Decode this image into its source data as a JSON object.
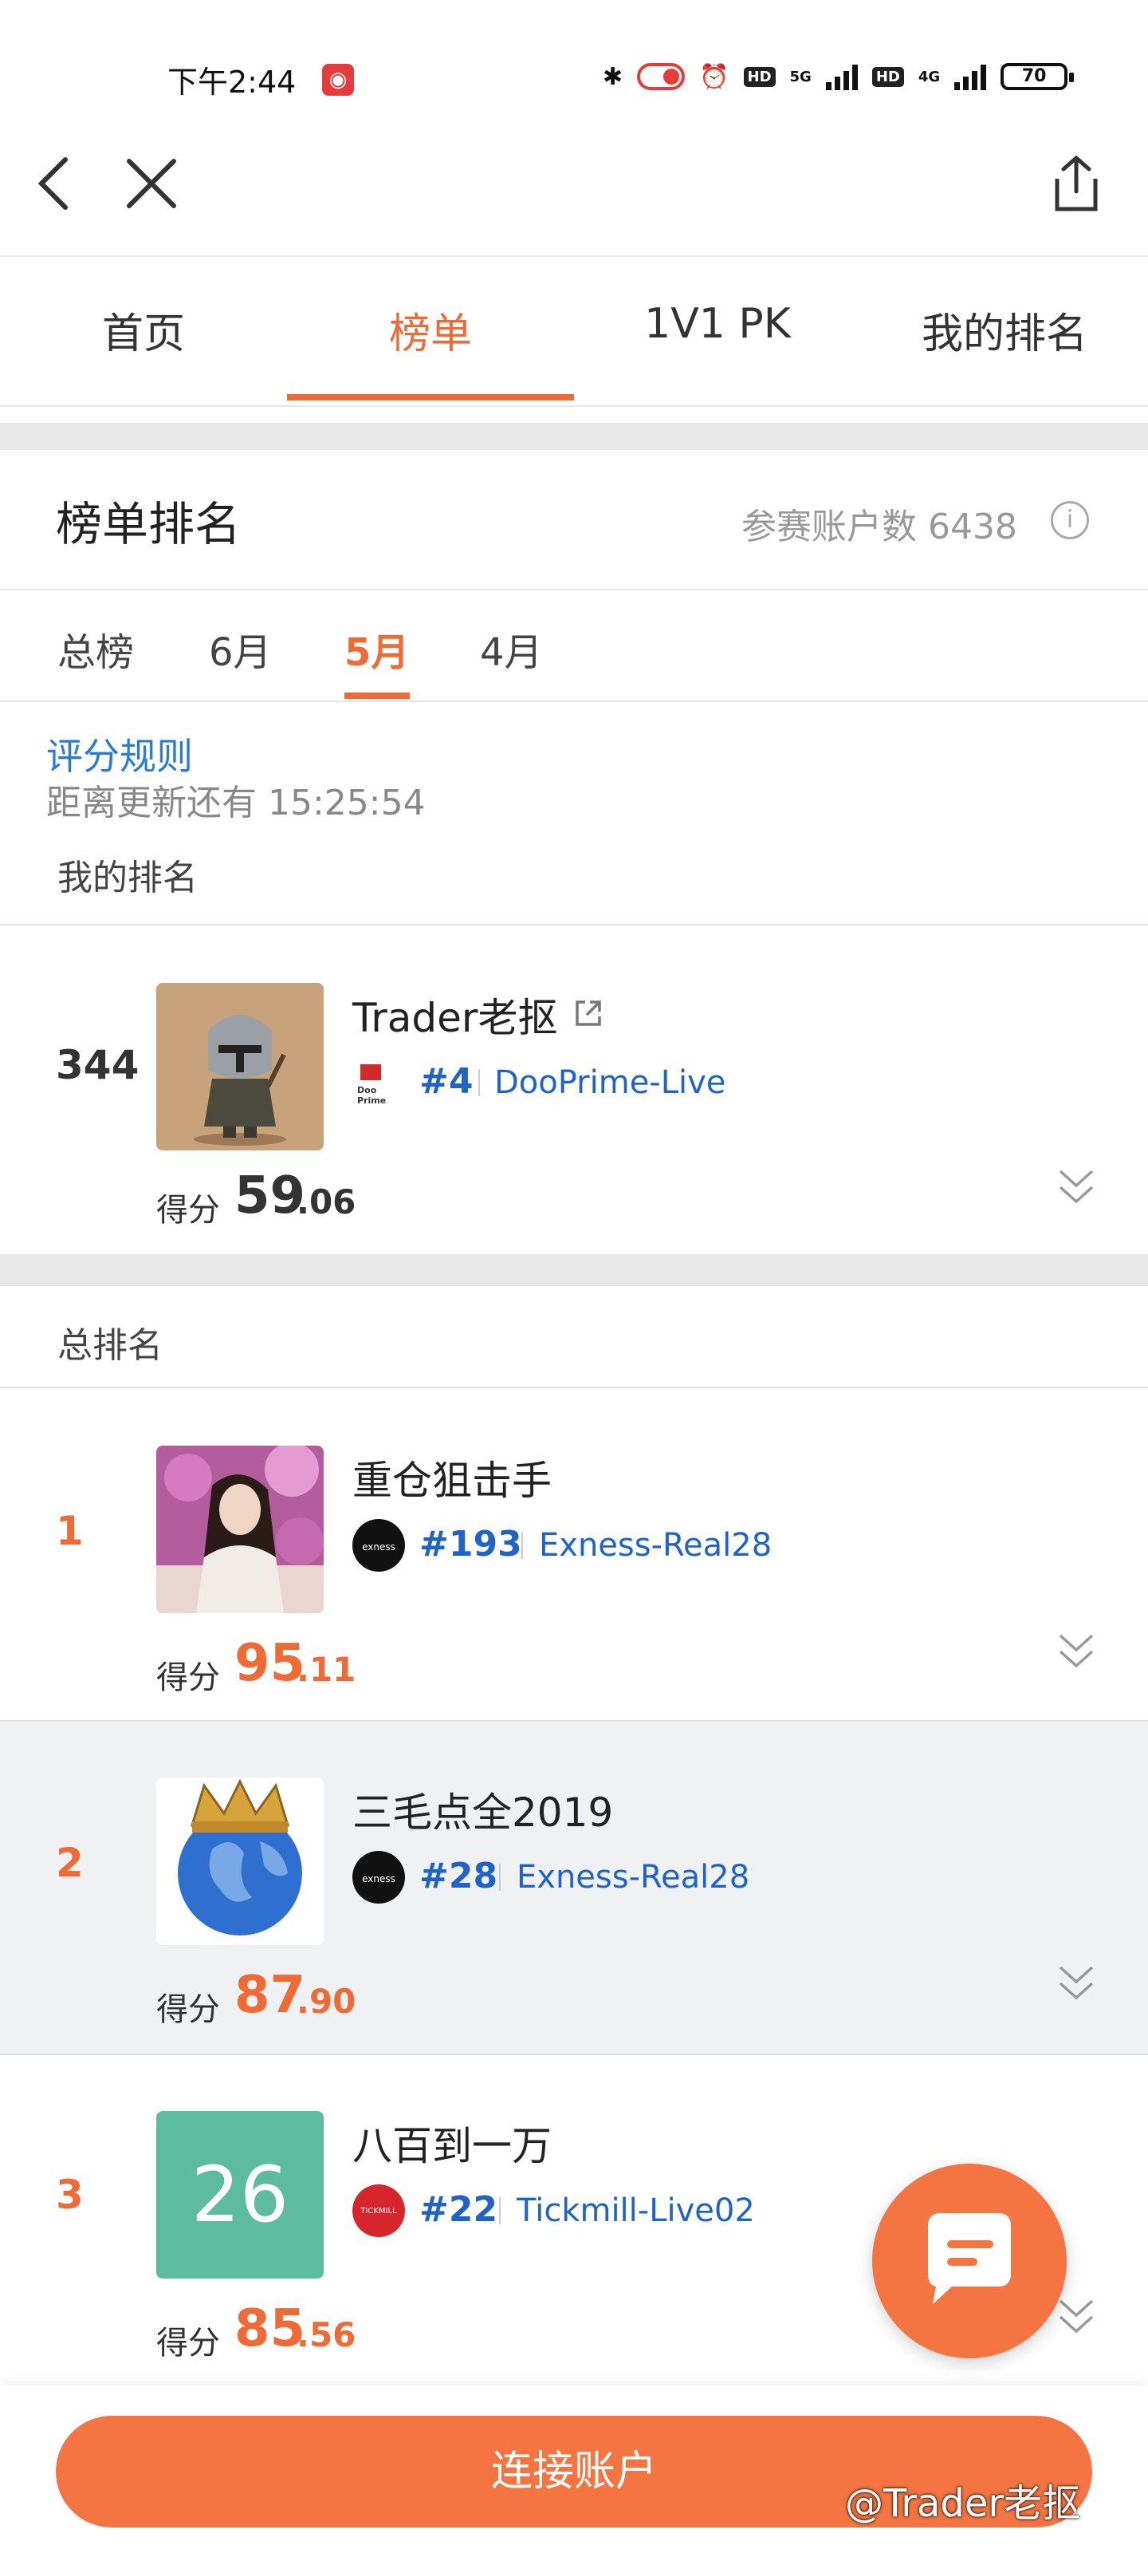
{
  "status_bar": {
    "time": "下午2:44",
    "network1": "5G",
    "network2": "4G",
    "hd": "HD",
    "battery": "70"
  },
  "tabs": [
    {
      "label": "首页"
    },
    {
      "label": "榜单"
    },
    {
      "label": "1V1 PK"
    },
    {
      "label": "我的排名"
    }
  ],
  "board": {
    "title": "榜单排名",
    "participants": "参赛账户数 6438",
    "periods": [
      "总榜",
      "6月",
      "5月",
      "4月"
    ],
    "active_period": "5月",
    "rules_link": "评分规则",
    "countdown": "距离更新还有 15:25:54"
  },
  "my_rank": {
    "label": "我的排名",
    "rank": "344",
    "name": "Trader老抠",
    "account": "#4",
    "server": "DooPrime-Live",
    "score_label": "得分",
    "score_int": "59",
    "score_dec": ".06"
  },
  "total_label": "总排名",
  "entries": [
    {
      "rank": "1",
      "name": "重仓狙击手",
      "account": "#193",
      "server": "Exness-Real28",
      "score_label": "得分",
      "score_int": "95",
      "score_dec": ".11",
      "broker": "exness"
    },
    {
      "rank": "2",
      "name": "三毛点全2019",
      "account": "#28",
      "server": "Exness-Real28",
      "score_label": "得分",
      "score_int": "87",
      "score_dec": ".90",
      "broker": "exness"
    },
    {
      "rank": "3",
      "name": "八百到一万",
      "account": "#22",
      "server": "Tickmill-Live02",
      "score_label": "得分",
      "score_int": "85",
      "score_dec": ".56",
      "broker": "tickmill",
      "avatar_text": "26"
    }
  ],
  "logos": {
    "exness": "exness",
    "tickmill": "TICKMILL",
    "dooprime": "Doo Prime"
  },
  "connect_button": "连接账户",
  "watermark": "@Trader老抠",
  "colors": {
    "accent": "#f06a35",
    "link": "#1f63c9",
    "fab": "#f47541"
  }
}
